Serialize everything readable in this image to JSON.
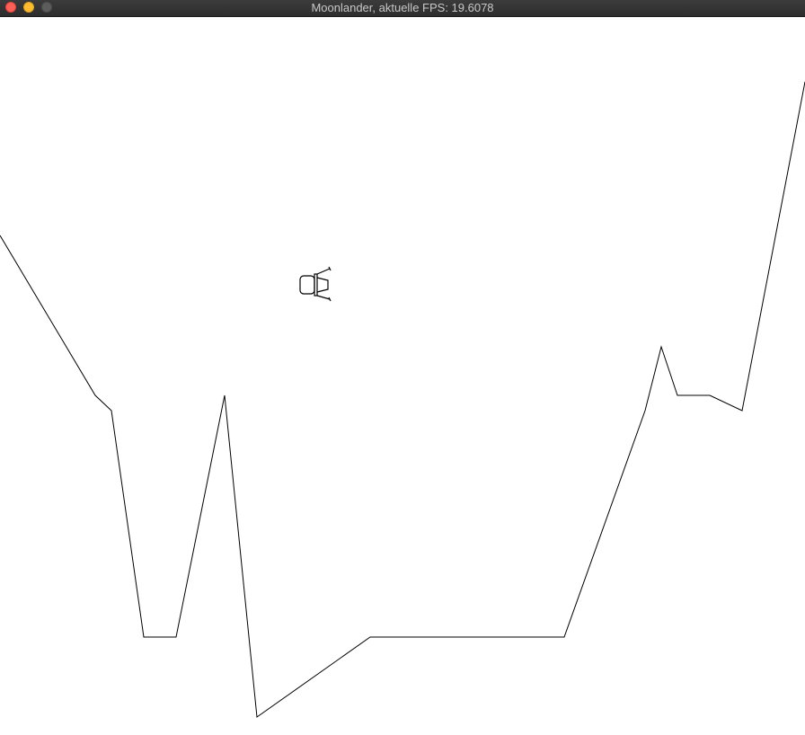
{
  "window": {
    "title": "Moonlander, aktuelle FPS: 19.6078",
    "buttons": {
      "close": "close-button",
      "minimize": "minimize-button",
      "zoom": "zoom-button"
    }
  },
  "game": {
    "background_color": "#ffffff",
    "terrain_color": "#000000",
    "lander_color": "#000000"
  }
}
